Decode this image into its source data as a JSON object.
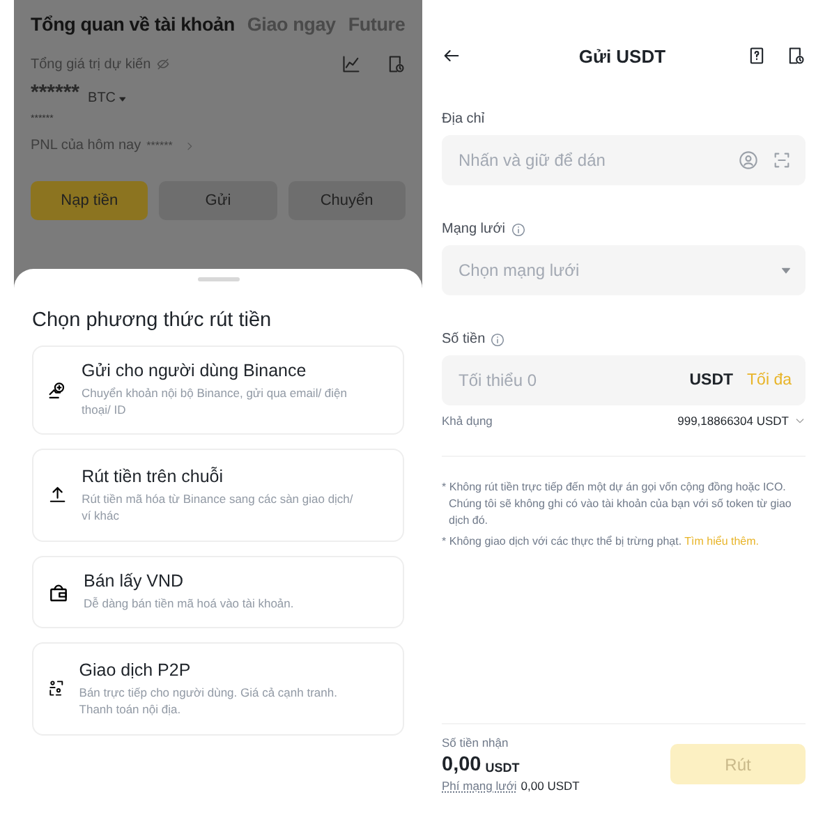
{
  "overview_screen": {
    "tabs": [
      {
        "label": "Tổng quan về tài khoản",
        "selected": true
      },
      {
        "label": "Giao ngay",
        "selected": false
      },
      {
        "label": "Future",
        "selected": false
      }
    ],
    "estimated_label": "Tổng giá trị dự kiến",
    "balance": "******",
    "currency": "BTC",
    "sub_balance": "******",
    "pnl_label": "PNL của hôm nay",
    "pnl_value": "******",
    "buttons": [
      {
        "label": "Nạp tiền",
        "kind": "primary"
      },
      {
        "label": "Gửi",
        "kind": "secondary"
      },
      {
        "label": "Chuyển",
        "kind": "secondary"
      }
    ]
  },
  "withdraw_sheet": {
    "title": "Chọn phương thức rút tiền",
    "methods": [
      {
        "title": "Gửi cho người dùng Binance",
        "description": "Chuyển khoản nội bộ Binance, gửi qua email/ điện thoại/ ID"
      },
      {
        "title": "Rút tiền trên chuỗi",
        "description": "Rút tiền mã hóa từ Binance sang các sàn giao dịch/ ví khác"
      },
      {
        "title": "Bán lấy VND",
        "description": "Dễ dàng bán tiền mã hoá vào tài khoản."
      },
      {
        "title": "Giao dịch P2P",
        "description": "Bán trực tiếp cho người dùng. Giá cả cạnh tranh. Thanh toán nội địa."
      }
    ]
  },
  "send_screen": {
    "title": "Gửi USDT",
    "address": {
      "label": "Địa chỉ",
      "placeholder": "Nhấn và giữ để dán"
    },
    "network": {
      "label": "Mạng lưới",
      "placeholder": "Chọn mạng lưới"
    },
    "amount": {
      "label": "Số tiền",
      "placeholder": "Tối thiểu 0",
      "unit": "USDT",
      "max": "Tối đa"
    },
    "available_label": "Khả dụng",
    "available_value": "999,18866304 USDT",
    "notes": [
      {
        "text": "Không rút tiền trực tiếp đến một dự án gọi vốn cộng đồng hoặc ICO. Chúng tôi sẽ không ghi có vào tài khoản của bạn với số token từ giao dịch đó."
      },
      {
        "text": "Không giao dịch với các thực thể bị trừng phạt.",
        "link": "Tìm hiểu thêm."
      }
    ],
    "note_mark": "*",
    "receive_label": "Số tiền nhận",
    "receive_value": "0,00",
    "receive_unit": "USDT",
    "fee_label": "Phí mạng lưới",
    "fee_value": "0,00 USDT",
    "submit": {
      "label": "Rút",
      "disabled": true
    }
  }
}
